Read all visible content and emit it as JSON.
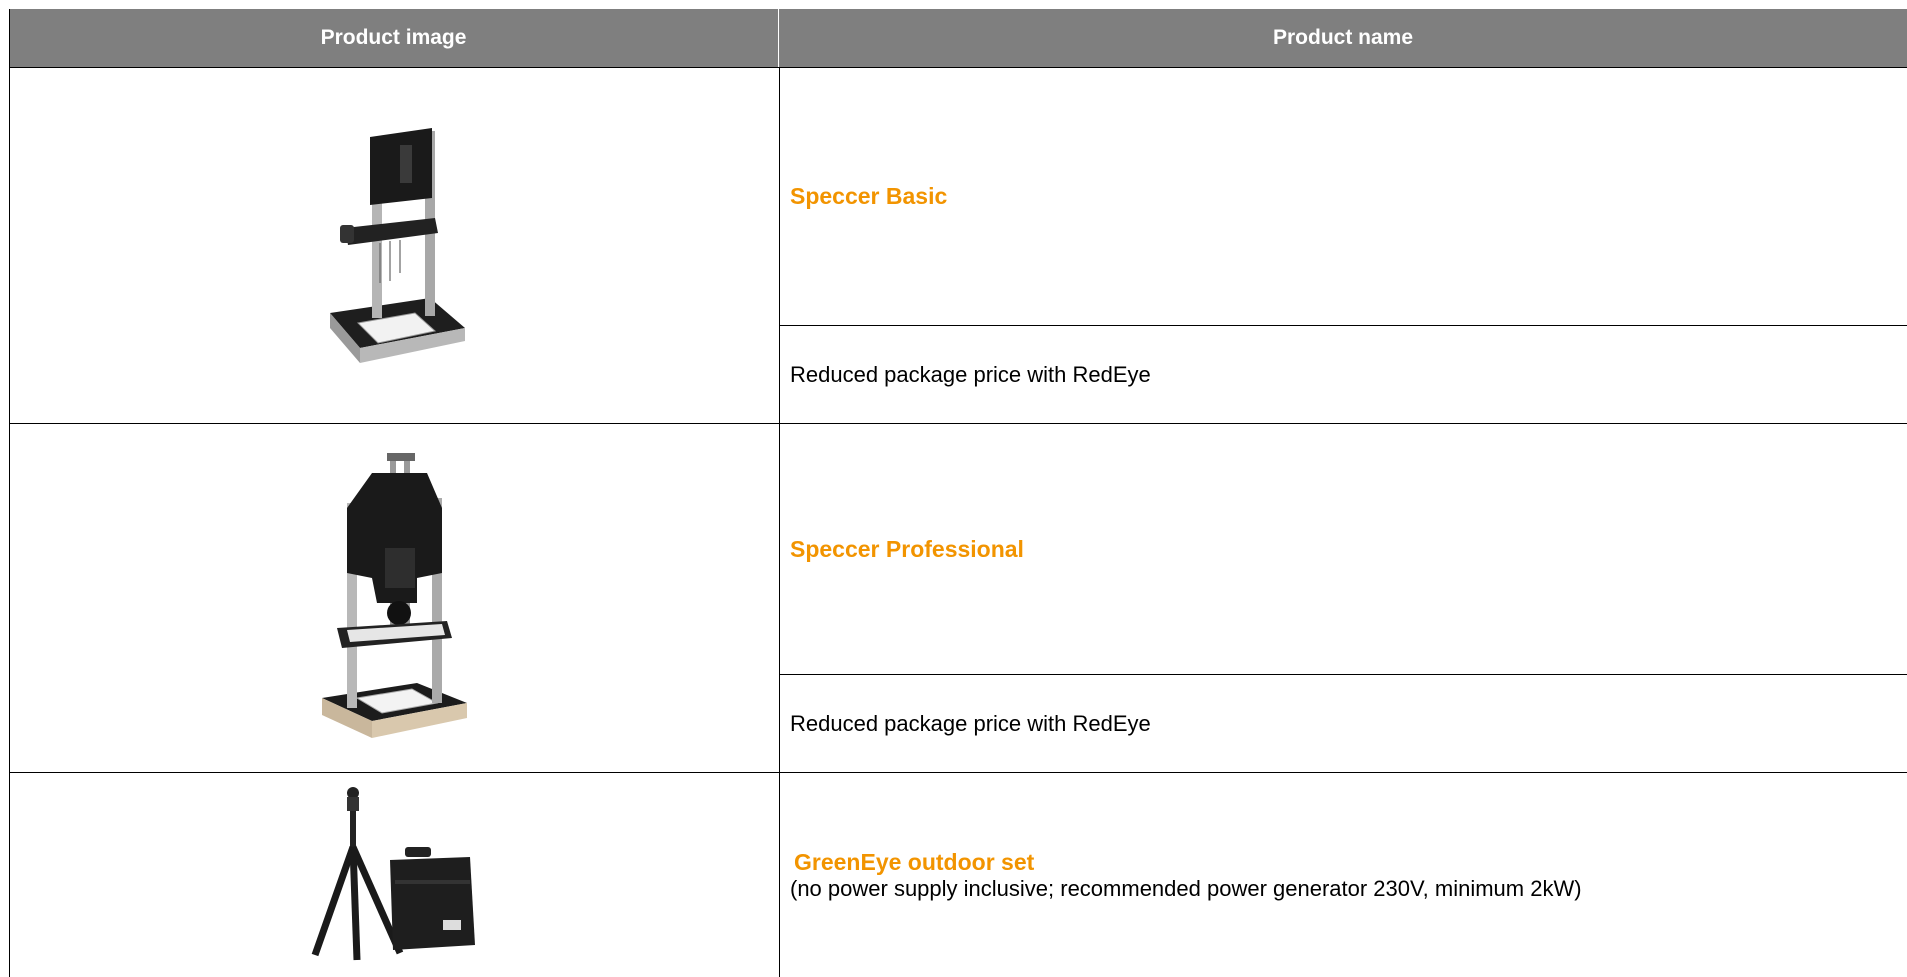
{
  "table": {
    "headers": [
      "Product image",
      "Product name"
    ],
    "rows": [
      {
        "image_icon": "speccer-basic-stand-image",
        "name": "Speccer Basic",
        "note": "Reduced package price with RedEye"
      },
      {
        "image_icon": "speccer-professional-stand-image",
        "name": "Speccer Professional",
        "note": "Reduced package price with RedEye"
      },
      {
        "image_icon": "greeneye-tripod-case-image",
        "name": "GreenEye outdoor set",
        "note": "(no power supply inclusive; recommended power generator 230V, minimum 2kW)"
      }
    ]
  },
  "colors": {
    "header_bg": "#7f7f7f",
    "header_text": "#ffffff",
    "product_name": "#f29400"
  }
}
